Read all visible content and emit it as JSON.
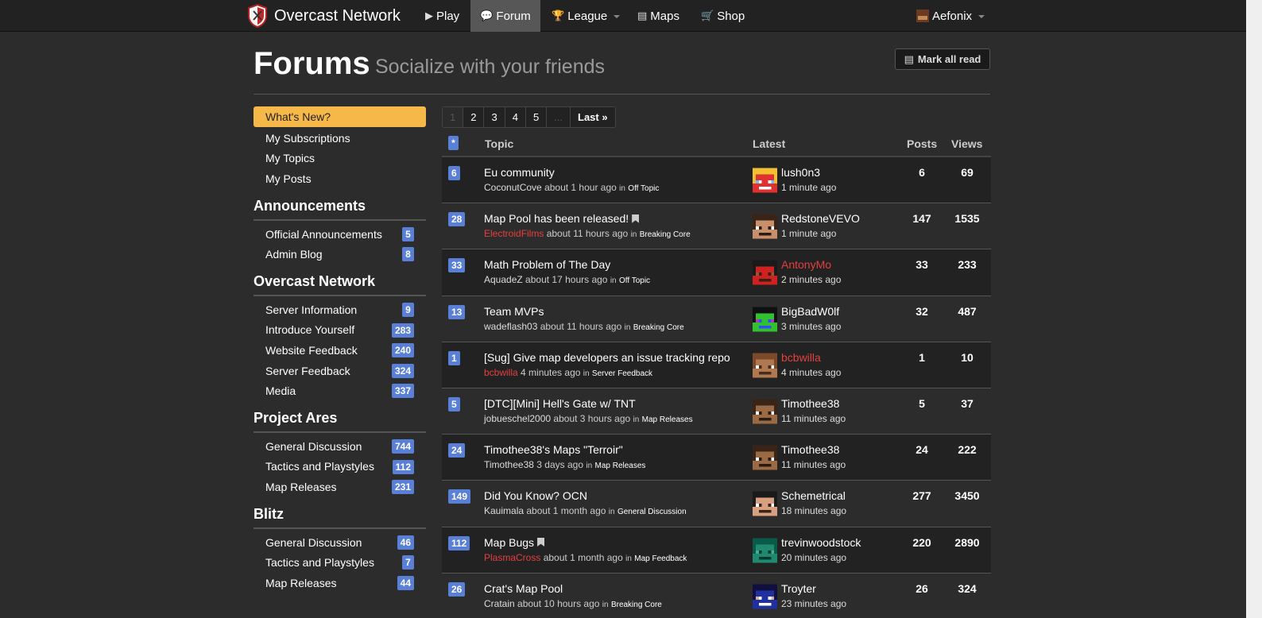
{
  "navbar": {
    "brand": "Overcast Network",
    "items": [
      {
        "label": "Play",
        "icon": "play-icon"
      },
      {
        "label": "Forum",
        "icon": "comments-icon"
      },
      {
        "label": "League",
        "icon": "trophy-icon"
      },
      {
        "label": "Maps",
        "icon": "list-icon"
      },
      {
        "label": "Shop",
        "icon": "cart-icon"
      }
    ],
    "user": "Aefonix"
  },
  "header": {
    "title": "Forums",
    "subtitle": "Socialize with your friends",
    "mark_all_read": "Mark all read"
  },
  "sidebar": {
    "whats_new": "What's New?",
    "links": [
      "My Subscriptions",
      "My Topics",
      "My Posts"
    ],
    "sections": [
      {
        "heading": "Announcements",
        "items": [
          {
            "label": "Official Announcements",
            "count": "5"
          },
          {
            "label": "Admin Blog",
            "count": "8"
          }
        ]
      },
      {
        "heading": "Overcast Network",
        "items": [
          {
            "label": "Server Information",
            "count": "9"
          },
          {
            "label": "Introduce Yourself",
            "count": "283"
          },
          {
            "label": "Website Feedback",
            "count": "240"
          },
          {
            "label": "Server Feedback",
            "count": "324"
          },
          {
            "label": "Media",
            "count": "337"
          }
        ]
      },
      {
        "heading": "Project Ares",
        "items": [
          {
            "label": "General Discussion",
            "count": "744"
          },
          {
            "label": "Tactics and Playstyles",
            "count": "112"
          },
          {
            "label": "Map Releases",
            "count": "231"
          }
        ]
      },
      {
        "heading": "Blitz",
        "items": [
          {
            "label": "General Discussion",
            "count": "46"
          },
          {
            "label": "Tactics and Playstyles",
            "count": "7"
          },
          {
            "label": "Map Releases",
            "count": "44"
          }
        ]
      }
    ]
  },
  "pagination": [
    "1",
    "2",
    "3",
    "4",
    "5",
    "...",
    "Last »"
  ],
  "table": {
    "star": "*",
    "headers": {
      "topic": "Topic",
      "latest": "Latest",
      "posts": "Posts",
      "views": "Views"
    },
    "rows": [
      {
        "replies": "6",
        "title": "Eu community",
        "author": "CoconutCove",
        "author_red": false,
        "time": "about 1 hour ago",
        "forum": "Off Topic",
        "bookmark": false,
        "latest_user": "lush0n3",
        "latest_red": false,
        "latest_time": "1 minute ago",
        "posts": "6",
        "views": "69",
        "skin": [
          "#f0c030",
          "#e03030",
          "#60c0ff",
          "#ffffff"
        ]
      },
      {
        "replies": "28",
        "title": "Map Pool has been released!",
        "author": "ElectroidFilms",
        "author_red": true,
        "time": "about 11 hours ago",
        "forum": "Breaking Core",
        "bookmark": true,
        "latest_user": "RedstoneVEVO",
        "latest_red": false,
        "latest_time": "1 minute ago",
        "posts": "147",
        "views": "1535",
        "skin": [
          "#3a2418",
          "#c8906a",
          "#ffffff",
          "#2a1a10"
        ]
      },
      {
        "replies": "33",
        "title": "Math Problem of The Day",
        "author": "AquadeZ",
        "author_red": false,
        "time": "about 17 hours ago",
        "forum": "Off Topic",
        "bookmark": false,
        "latest_user": "AntonyMo",
        "latest_red": true,
        "latest_time": "2 minutes ago",
        "posts": "33",
        "views": "233",
        "skin": [
          "#1a1a1a",
          "#d02020",
          "#8a5a3a",
          "#3a2010"
        ]
      },
      {
        "replies": "13",
        "title": "Team MVPs",
        "author": "wadeflash03",
        "author_red": false,
        "time": "about 11 hours ago",
        "forum": "Breaking Core",
        "bookmark": false,
        "latest_user": "BigBadW0lf",
        "latest_red": false,
        "latest_time": "3 minutes ago",
        "posts": "32",
        "views": "487",
        "skin": [
          "#101010",
          "#30c030",
          "#c030c0",
          "#3050f0"
        ]
      },
      {
        "replies": "1",
        "title": "[Sug] Give map developers an issue tracking repo",
        "author": "bcbwilla",
        "author_red": true,
        "time": "4 minutes ago",
        "forum": "Server Feedback",
        "bookmark": false,
        "latest_user": "bcbwilla",
        "latest_red": true,
        "latest_time": "4 minutes ago",
        "posts": "1",
        "views": "10",
        "skin": [
          "#7a4a2a",
          "#b07850",
          "#ffffff",
          "#4a2a18"
        ]
      },
      {
        "replies": "5",
        "title": "[DTC][Mini] Hell's Gate w/ TNT",
        "author": "jobueschel2000",
        "author_red": false,
        "time": "about 3 hours ago",
        "forum": "Map Releases",
        "bookmark": false,
        "latest_user": "Timothee38",
        "latest_red": false,
        "latest_time": "11 minutes ago",
        "posts": "5",
        "views": "37",
        "skin": [
          "#3a2418",
          "#9a6a44",
          "#ffffff",
          "#2a1a10"
        ]
      },
      {
        "replies": "24",
        "title": "Timothee38's Maps \"Terroir\"",
        "author": "Timothee38",
        "author_red": false,
        "time": "3 days ago",
        "forum": "Map Releases",
        "bookmark": false,
        "latest_user": "Timothee38",
        "latest_red": false,
        "latest_time": "11 minutes ago",
        "posts": "24",
        "views": "222",
        "skin": [
          "#3a2418",
          "#9a6a44",
          "#ffffff",
          "#2a1a10"
        ]
      },
      {
        "replies": "149",
        "title": "Did You Know? OCN",
        "author": "Kauimala",
        "author_red": false,
        "time": "about 1 month ago",
        "forum": "General Discussion",
        "bookmark": false,
        "latest_user": "Schemetrical",
        "latest_red": false,
        "latest_time": "18 minutes ago",
        "posts": "277",
        "views": "3450",
        "skin": [
          "#1a1a1a",
          "#d8a080",
          "#ffffff",
          "#3a2418"
        ]
      },
      {
        "replies": "112",
        "title": "Map Bugs",
        "author": "PlasmaCross",
        "author_red": true,
        "time": "about 1 month ago",
        "forum": "Map Feedback",
        "bookmark": true,
        "latest_user": "trevinwoodstock",
        "latest_red": false,
        "latest_time": "20 minutes ago",
        "posts": "220",
        "views": "2890",
        "skin": [
          "#0a5a4a",
          "#208a70",
          "#40b090",
          "#063a30"
        ]
      },
      {
        "replies": "26",
        "title": "Crat's Map Pool",
        "author": "Cratain",
        "author_red": false,
        "time": "about 10 hours ago",
        "forum": "Breaking Core",
        "bookmark": false,
        "latest_user": "Troyter",
        "latest_red": false,
        "latest_time": "23 minutes ago",
        "posts": "26",
        "views": "324",
        "skin": [
          "#101040",
          "#2030a0",
          "#d8b090",
          "#ffffff"
        ]
      }
    ]
  }
}
